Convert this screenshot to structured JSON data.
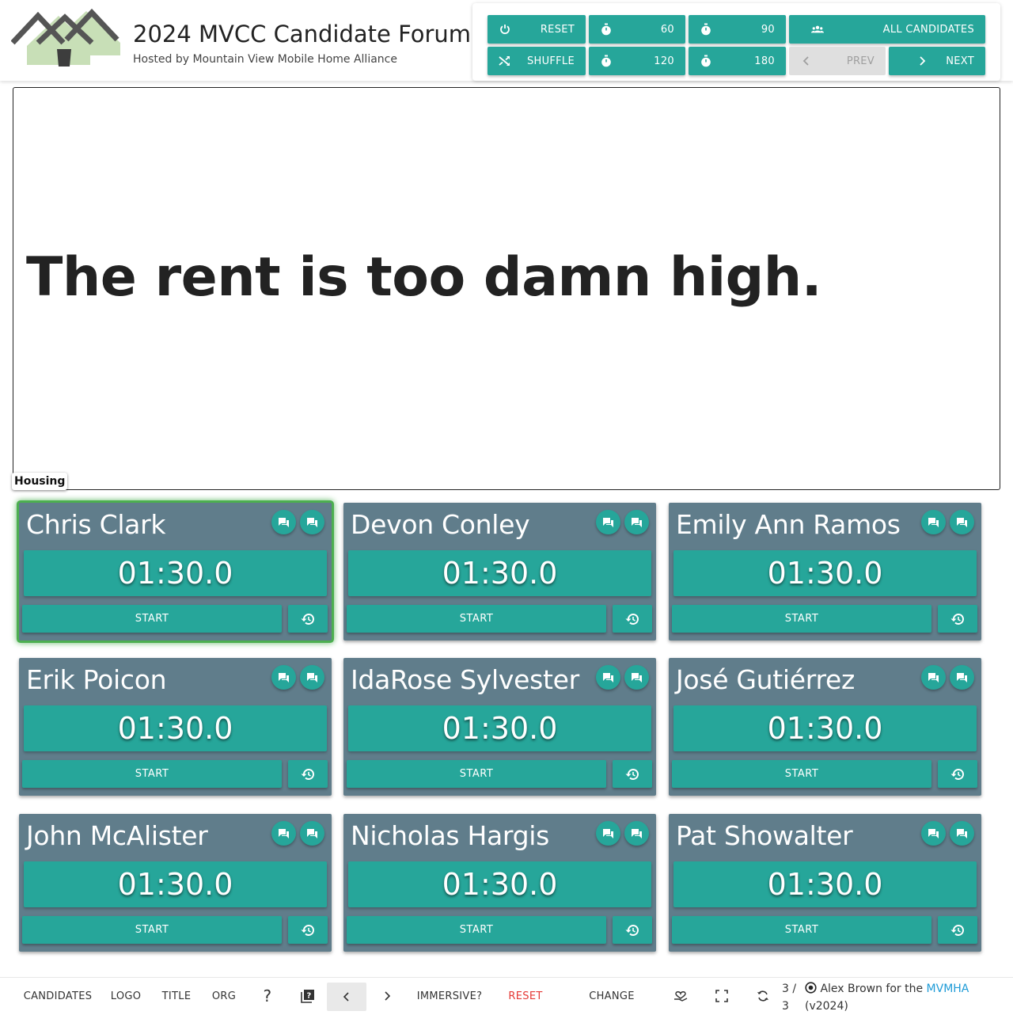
{
  "header": {
    "title": "2024 MVCC Candidate Forum",
    "subtitle": "Hosted by Mountain View Mobile Home Alliance"
  },
  "controls": {
    "reset": "RESET",
    "shuffle": "SHUFFLE",
    "t60": "60",
    "t90": "90",
    "t120": "120",
    "t180": "180",
    "all_candidates": "ALL CANDIDATES",
    "prev": "PREV",
    "next": "NEXT"
  },
  "question": {
    "text": "The rent is too damn high.",
    "topic": "Housing"
  },
  "candidates": [
    {
      "name": "Chris Clark",
      "time": "01:30.0",
      "start": "START"
    },
    {
      "name": "Devon Conley",
      "time": "01:30.0",
      "start": "START"
    },
    {
      "name": "Emily Ann Ramos",
      "time": "01:30.0",
      "start": "START"
    },
    {
      "name": "Erik Poicon",
      "time": "01:30.0",
      "start": "START"
    },
    {
      "name": "IdaRose Sylvester",
      "time": "01:30.0",
      "start": "START"
    },
    {
      "name": "José Gutiérrez",
      "time": "01:30.0",
      "start": "START"
    },
    {
      "name": "John McAlister",
      "time": "01:30.0",
      "start": "START"
    },
    {
      "name": "Nicholas Hargis",
      "time": "01:30.0",
      "start": "START"
    },
    {
      "name": "Pat Showalter",
      "time": "01:30.0",
      "start": "START"
    }
  ],
  "active_candidate_index": 0,
  "footer": {
    "candidates": "CANDIDATES",
    "logo": "LOGO",
    "title": "TITLE",
    "org": "ORG",
    "help": "?",
    "immersive": "IMMERSIVE?",
    "reset": "RESET",
    "change": "CHANGE",
    "page_current": "3 /",
    "page_total": "3",
    "credit_prefix": "Alex Brown for the",
    "credit_link": "MVMHA",
    "version": "(v2024)"
  },
  "colors": {
    "accent": "#26a69a",
    "card": "#607d8b",
    "active_glow": "#4caf50",
    "reset_red": "#e53935",
    "link": "#1e9bd7"
  }
}
